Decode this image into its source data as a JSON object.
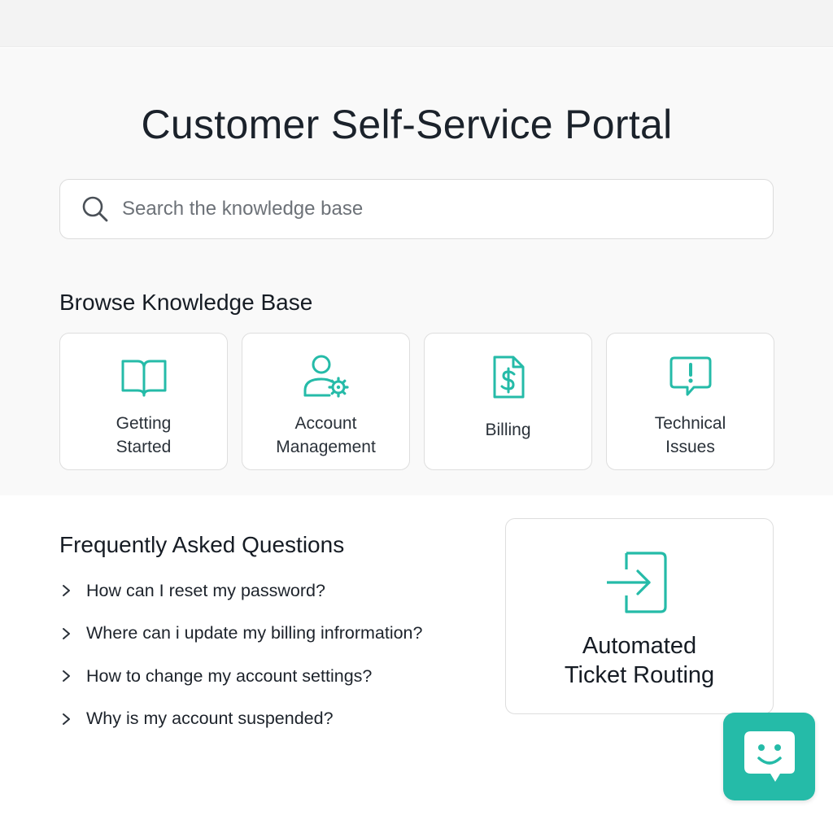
{
  "colors": {
    "accent": "#25bba8",
    "text": "#1d232b",
    "hero_bg": "#f9f9f9"
  },
  "header": {
    "title": "Customer Self-Service Portal"
  },
  "search": {
    "placeholder": "Search the knowledge base",
    "value": "",
    "icon": "search-icon"
  },
  "browse": {
    "title": "Browse Knowledge Base",
    "categories": [
      {
        "label": "Getting\nStarted",
        "icon": "open-book-icon"
      },
      {
        "label": "Account\nManagement",
        "icon": "user-gear-icon"
      },
      {
        "label": "Billing",
        "icon": "billing-document-icon"
      },
      {
        "label": "Technical\nIssues",
        "icon": "alert-chat-icon"
      }
    ]
  },
  "faq": {
    "title": "Frequently Asked Questions",
    "items": [
      "How can I reset my password?",
      "Where can i update my billing infrormation?",
      "How to change my account settings?",
      "Why is my account suspended?"
    ]
  },
  "routing_card": {
    "label": "Automated\nTicket Routing",
    "icon": "sign-in-arrow-icon"
  },
  "chat_button": {
    "icon": "smiley-chat-icon"
  }
}
